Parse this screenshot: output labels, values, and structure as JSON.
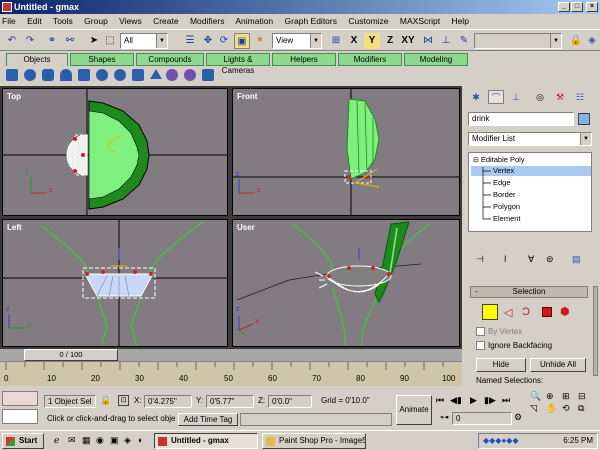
{
  "window": {
    "title": "Untitled - gmax",
    "min": "_",
    "max": "□",
    "close": "×"
  },
  "menu": [
    "File",
    "Edit",
    "Tools",
    "Group",
    "Views",
    "Create",
    "Modifiers",
    "Animation",
    "Graph Editors",
    "Customize",
    "MAXScript",
    "Help"
  ],
  "toolbar": {
    "selection_filter": "All",
    "ref_coord": "View",
    "axis_x": "X",
    "axis_y": "Y",
    "axis_z": "Z",
    "axis_xy": "XY"
  },
  "tabs": [
    "Objects",
    "Shapes",
    "Compounds",
    "Lights & Cameras",
    "Helpers",
    "Modifiers",
    "Modeling"
  ],
  "viewports": {
    "top": "Top",
    "front": "Front",
    "left": "Left",
    "user": "User"
  },
  "axes": {
    "x": "x",
    "y": "y",
    "z": "z"
  },
  "command_panel": {
    "object_name": "drink",
    "modifier_list": "Modifier List",
    "stack": [
      "Editable Poly",
      "Vertex",
      "Edge",
      "Border",
      "Polygon",
      "Element"
    ],
    "selection_rollout": {
      "title": "Selection",
      "expand": "-",
      "by_vertex": "By Vertex",
      "ignore_backfacing": "Ignore Backfacing",
      "hide": "Hide",
      "unhide_all": "Unhide All",
      "named_selections": "Named Selections:"
    }
  },
  "timeline": {
    "slider": "0 / 100",
    "ticks": [
      "0",
      "10",
      "20",
      "30",
      "40",
      "50",
      "60",
      "70",
      "80",
      "90",
      "100"
    ]
  },
  "status": {
    "selected": "1 Object Sel",
    "x_label": "X:",
    "x_value": "0'4.275\"",
    "y_label": "Y:",
    "y_value": "0'5.77\"",
    "z_label": "Z:",
    "z_value": "0'0.0\"",
    "grid": "Grid = 0'10.0\"",
    "prompt": "Click or click-and-drag to select obje",
    "add_time_tag": "Add Time Tag",
    "animate": "Animate",
    "frame": "0"
  },
  "taskbar": {
    "start": "Start",
    "tasks": [
      "Untitled - gmax",
      "Paint Shop Pro - Image5"
    ],
    "clock": "6:25 PM"
  },
  "colors": {
    "viewport_bg": "#827c82",
    "object_fill": "#7df07d",
    "object_dark": "#1e8a1e",
    "selection": "#e8e8ff",
    "grid_line": "#000000"
  }
}
